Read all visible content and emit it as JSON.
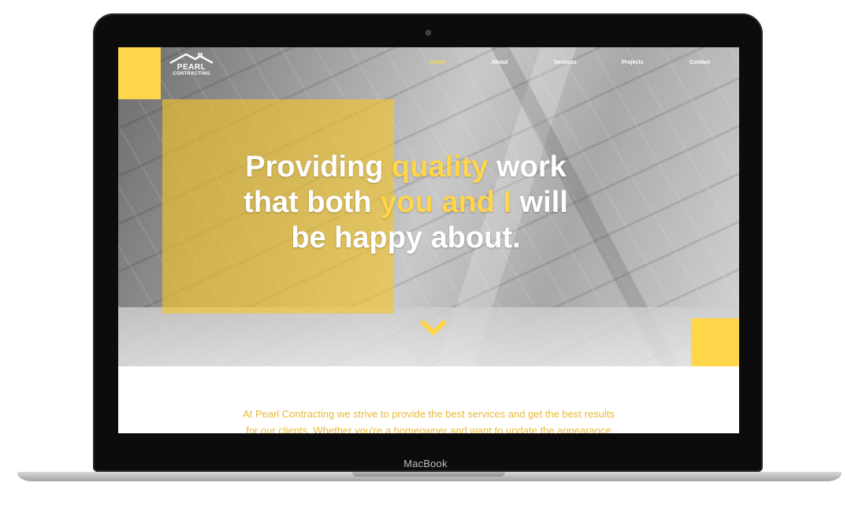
{
  "device": {
    "label": "MacBook"
  },
  "site": {
    "logo": {
      "line1": "PEARL",
      "line2": "CONTRACTING"
    },
    "nav": [
      {
        "label": "Home",
        "active": true
      },
      {
        "label": "About",
        "active": false
      },
      {
        "label": "Services",
        "active": false
      },
      {
        "label": "Projects",
        "active": false
      },
      {
        "label": "Contact",
        "active": false
      }
    ],
    "hero": {
      "line1_a": "Providing ",
      "line1_hl": "quality",
      "line1_b": " work",
      "line2_a": "that both ",
      "line2_hl": "you and I",
      "line2_b": " will",
      "line3": "be happy about."
    },
    "intro": {
      "line1": "At Pearl Contracting we strive to provide the best services and get the best results",
      "line2": "for our clients. Whether you're a homeowner and want to update the appearance"
    },
    "colors": {
      "accent": "#ffd54a",
      "intro_text": "#e8b93a"
    },
    "icons": {
      "scroll": "chevron-down-icon",
      "logo": "roof-icon"
    }
  }
}
